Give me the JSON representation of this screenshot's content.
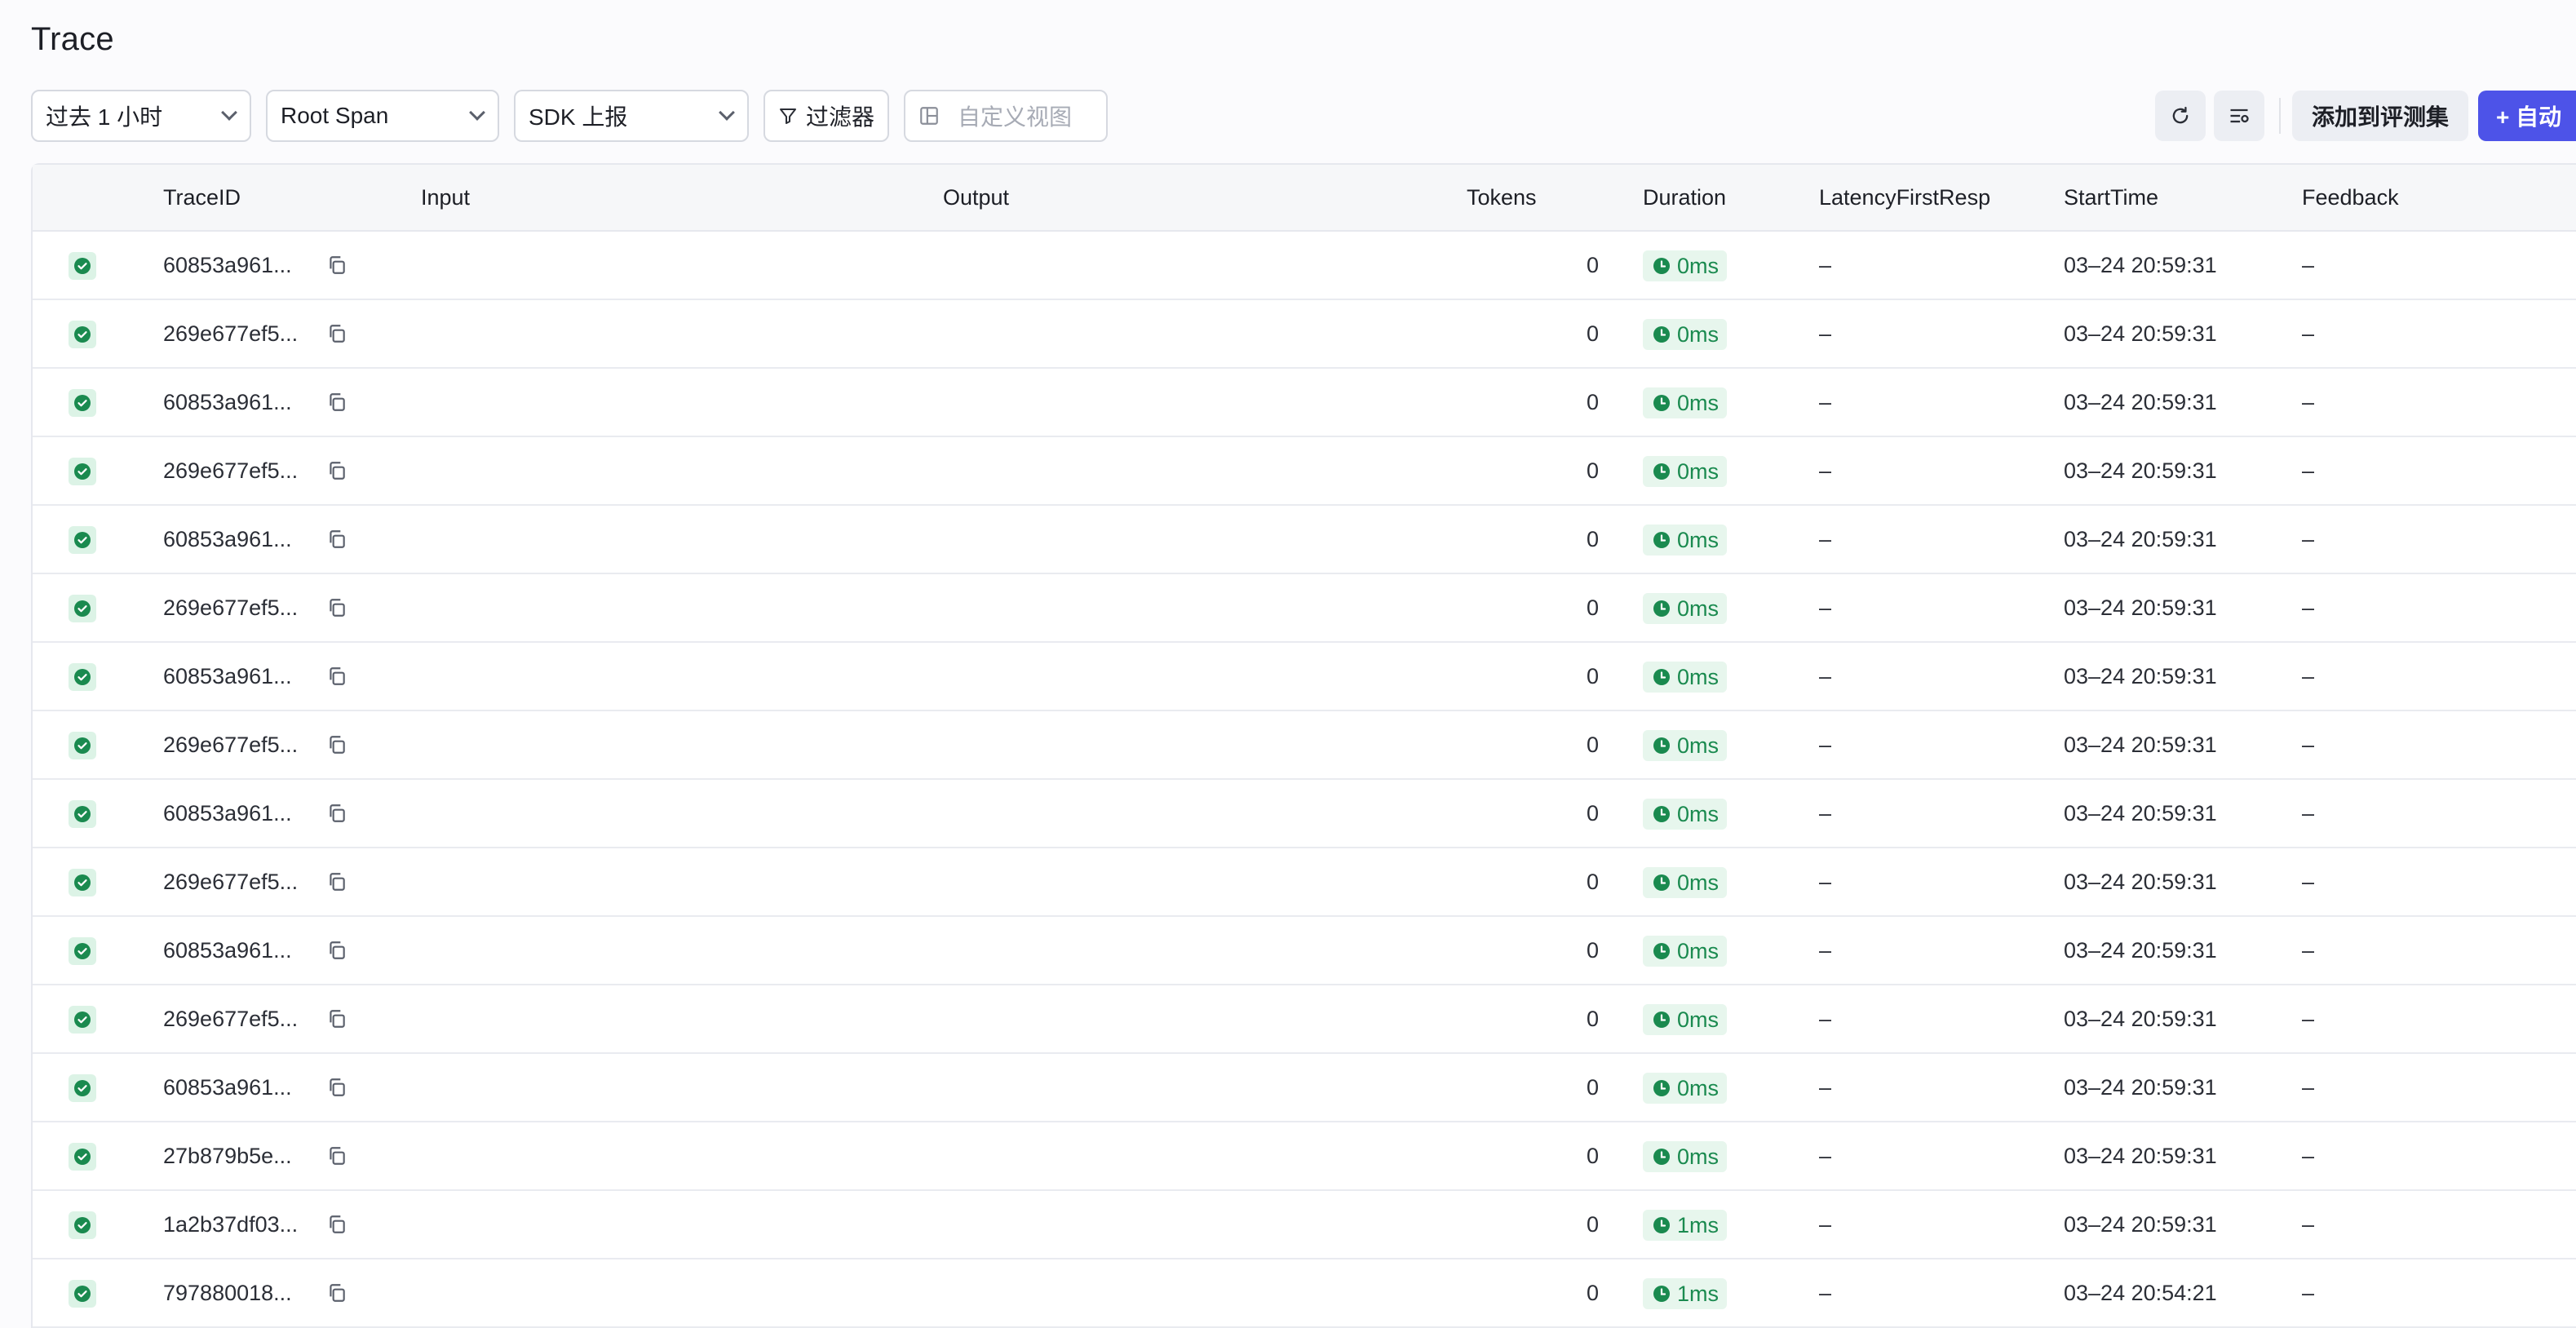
{
  "page": {
    "title": "Trace"
  },
  "toolbar": {
    "time_range": "过去 1 小时",
    "span_type": "Root Span",
    "source": "SDK 上报",
    "filter_label": "过滤器",
    "custom_view_label": "自定义视图",
    "add_to_eval_label": "添加到评测集",
    "auto_label": "+ 自动"
  },
  "table": {
    "headers": {
      "trace_id": "TraceID",
      "input": "Input",
      "output": "Output",
      "tokens": "Tokens",
      "duration": "Duration",
      "latency": "LatencyFirstResp",
      "start_time": "StartTime",
      "feedback": "Feedback"
    },
    "rows": [
      {
        "trace_id": "60853a961...",
        "tokens": "0",
        "duration": "0ms",
        "latency": "–",
        "start_time": "03–24 20:59:31",
        "feedback": "–"
      },
      {
        "trace_id": "269e677ef5...",
        "tokens": "0",
        "duration": "0ms",
        "latency": "–",
        "start_time": "03–24 20:59:31",
        "feedback": "–"
      },
      {
        "trace_id": "60853a961...",
        "tokens": "0",
        "duration": "0ms",
        "latency": "–",
        "start_time": "03–24 20:59:31",
        "feedback": "–"
      },
      {
        "trace_id": "269e677ef5...",
        "tokens": "0",
        "duration": "0ms",
        "latency": "–",
        "start_time": "03–24 20:59:31",
        "feedback": "–"
      },
      {
        "trace_id": "60853a961...",
        "tokens": "0",
        "duration": "0ms",
        "latency": "–",
        "start_time": "03–24 20:59:31",
        "feedback": "–"
      },
      {
        "trace_id": "269e677ef5...",
        "tokens": "0",
        "duration": "0ms",
        "latency": "–",
        "start_time": "03–24 20:59:31",
        "feedback": "–"
      },
      {
        "trace_id": "60853a961...",
        "tokens": "0",
        "duration": "0ms",
        "latency": "–",
        "start_time": "03–24 20:59:31",
        "feedback": "–"
      },
      {
        "trace_id": "269e677ef5...",
        "tokens": "0",
        "duration": "0ms",
        "latency": "–",
        "start_time": "03–24 20:59:31",
        "feedback": "–"
      },
      {
        "trace_id": "60853a961...",
        "tokens": "0",
        "duration": "0ms",
        "latency": "–",
        "start_time": "03–24 20:59:31",
        "feedback": "–"
      },
      {
        "trace_id": "269e677ef5...",
        "tokens": "0",
        "duration": "0ms",
        "latency": "–",
        "start_time": "03–24 20:59:31",
        "feedback": "–"
      },
      {
        "trace_id": "60853a961...",
        "tokens": "0",
        "duration": "0ms",
        "latency": "–",
        "start_time": "03–24 20:59:31",
        "feedback": "–"
      },
      {
        "trace_id": "269e677ef5...",
        "tokens": "0",
        "duration": "0ms",
        "latency": "–",
        "start_time": "03–24 20:59:31",
        "feedback": "–"
      },
      {
        "trace_id": "60853a961...",
        "tokens": "0",
        "duration": "0ms",
        "latency": "–",
        "start_time": "03–24 20:59:31",
        "feedback": "–"
      },
      {
        "trace_id": "27b879b5e...",
        "tokens": "0",
        "duration": "0ms",
        "latency": "–",
        "start_time": "03–24 20:59:31",
        "feedback": "–"
      },
      {
        "trace_id": "1a2b37df03...",
        "tokens": "0",
        "duration": "1ms",
        "latency": "–",
        "start_time": "03–24 20:59:31",
        "feedback": "–"
      },
      {
        "trace_id": "797880018...",
        "tokens": "0",
        "duration": "1ms",
        "latency": "–",
        "start_time": "03–24 20:54:21",
        "feedback": "–"
      }
    ]
  },
  "colors": {
    "accent": "#4d53e8",
    "success": "#1a8a4f"
  }
}
